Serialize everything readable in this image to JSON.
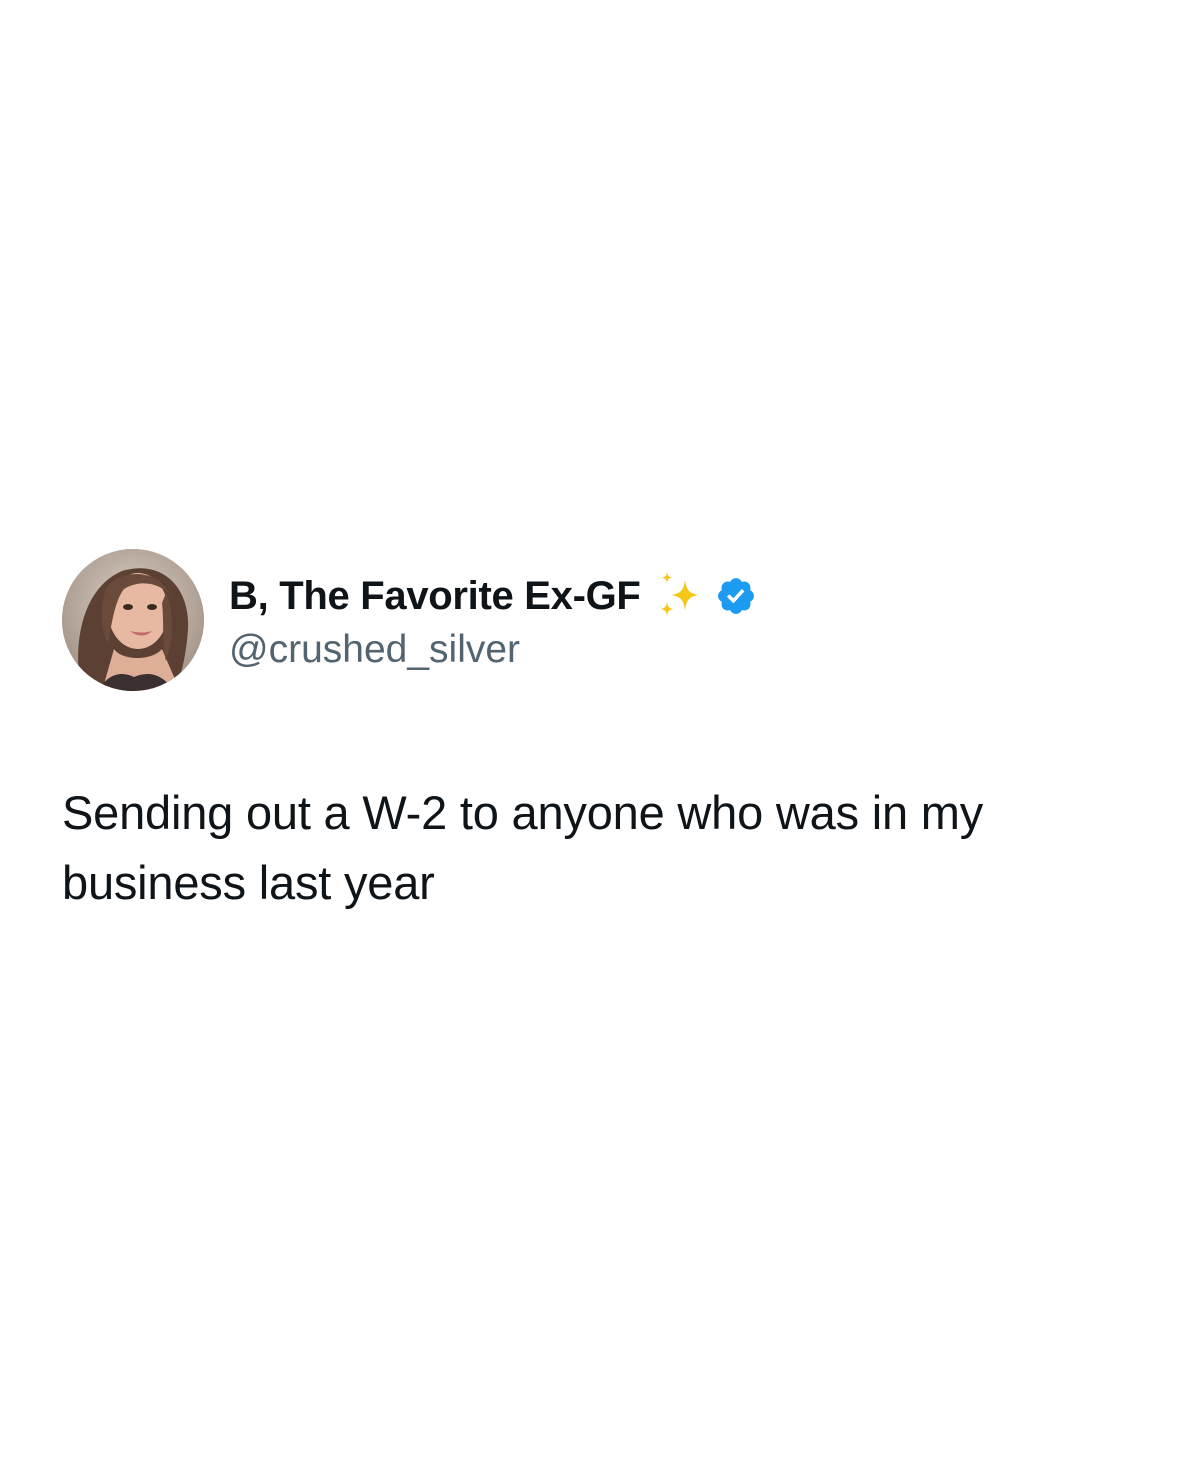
{
  "tweet": {
    "author": {
      "display_name": "B, The Favorite Ex-GF",
      "handle": "@crushed_silver",
      "name_emoji_icon": "sparkles-icon",
      "verified_icon": "verified-badge-icon",
      "verified_color": "#1d9bf0"
    },
    "text": "Sending out a W-2 to anyone who was in my business last year"
  },
  "colors": {
    "background": "#ffffff",
    "primary_text": "#0f1419",
    "secondary_text": "#536471",
    "sparkle": "#f5c518"
  }
}
